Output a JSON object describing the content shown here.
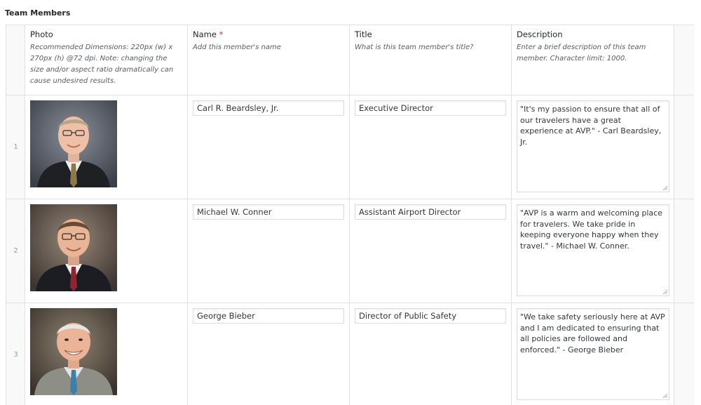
{
  "field_label": "Team Members",
  "columns": {
    "photo": {
      "title": "Photo",
      "instructions": "Recommended Dimensions: 220px (w) x 270px (h) @72 dpi. Note: changing the size and/or aspect ratio dramatically can cause undesired results."
    },
    "name": {
      "title": "Name",
      "required_mark": "*",
      "instructions": "Add this member's name"
    },
    "title": {
      "title": "Title",
      "instructions": "What is this team member's title?"
    },
    "description": {
      "title": "Description",
      "instructions": "Enter a brief description of this team member. Character limit: 1000."
    }
  },
  "rows": [
    {
      "index": "1",
      "photo_icon": "portrait-photo-icon",
      "name": "Carl R. Beardsley, Jr.",
      "title": "Executive Director",
      "description": "\"It's my passion to ensure that all of our travelers have a great experience at AVP.\" - Carl Beardsley, Jr."
    },
    {
      "index": "2",
      "photo_icon": "portrait-photo-icon",
      "name": "Michael W. Conner",
      "title": "Assistant Airport Director",
      "description": "\"AVP is a warm and welcoming place for travelers. We take pride in keeping everyone happy when they travel.\" - Michael W. Conner."
    },
    {
      "index": "3",
      "photo_icon": "portrait-photo-icon",
      "name": "George Bieber",
      "title": "Director of Public Safety",
      "description": "\"We take safety seriously here at AVP and I am dedicated to ensuring that all policies are followed and enforced.\" - George Bieber"
    }
  ],
  "colors": {
    "border": "#e1e1e1",
    "required": "#dc3232",
    "muted_text": "#555d66",
    "gutter_bg": "#f9f9f9"
  }
}
